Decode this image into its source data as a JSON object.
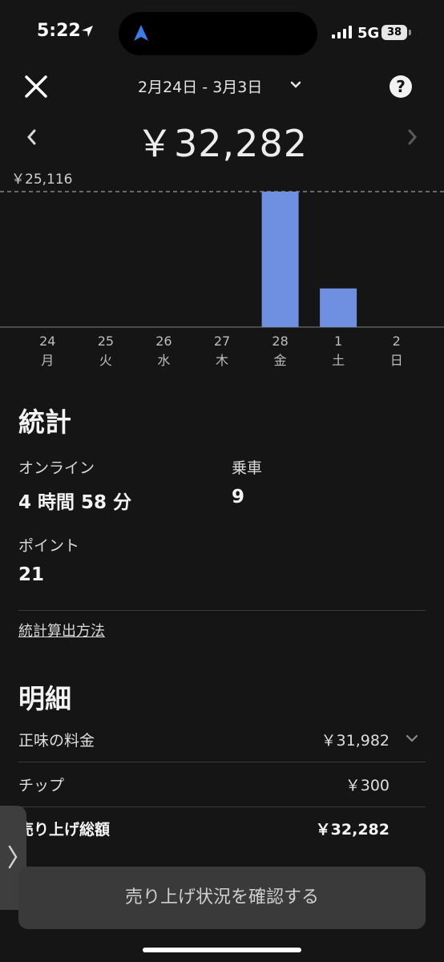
{
  "status_bar": {
    "time": "5:22",
    "network": "5G",
    "battery": "38",
    "icons": [
      "location-arrow-icon",
      "navigation-arrow-icon",
      "signal-bars-icon"
    ]
  },
  "header": {
    "date_range": "2月24日 - 3月3日",
    "total": "￥32,282",
    "help_label": "?",
    "icons": [
      "close-icon",
      "chevron-down-icon",
      "help-icon",
      "chevron-left-icon",
      "chevron-right-icon"
    ]
  },
  "chart_data": {
    "type": "bar",
    "max_label": "￥25,116",
    "categories": [
      {
        "day": "24",
        "weekday": "月"
      },
      {
        "day": "25",
        "weekday": "火"
      },
      {
        "day": "26",
        "weekday": "水"
      },
      {
        "day": "27",
        "weekday": "木"
      },
      {
        "day": "28",
        "weekday": "金"
      },
      {
        "day": "1",
        "weekday": "土"
      },
      {
        "day": "2",
        "weekday": "日"
      }
    ],
    "values": [
      0,
      0,
      0,
      0,
      25116,
      7166,
      0
    ],
    "ylim": [
      0,
      25116
    ],
    "bar_color": "#6f8fe0"
  },
  "stats": {
    "title": "統計",
    "online_label": "オンライン",
    "online_value": "4 時間 58 分",
    "rides_label": "乗車",
    "rides_value": "9",
    "points_label": "ポイント",
    "points_value": "21",
    "method_link": "統計算出方法"
  },
  "breakdown": {
    "title": "明細",
    "net_fare_label": "正味の料金",
    "net_fare_value": "￥31,982",
    "tip_label": "チップ",
    "tip_value": "￥300",
    "total_label": "売り上げ総額",
    "total_value": "￥32,282"
  },
  "cta": {
    "label": "売り上げ状況を確認する"
  },
  "colors": {
    "background": "#151515",
    "accent_bar": "#6f8fe0",
    "button": "#3a3a3a"
  }
}
